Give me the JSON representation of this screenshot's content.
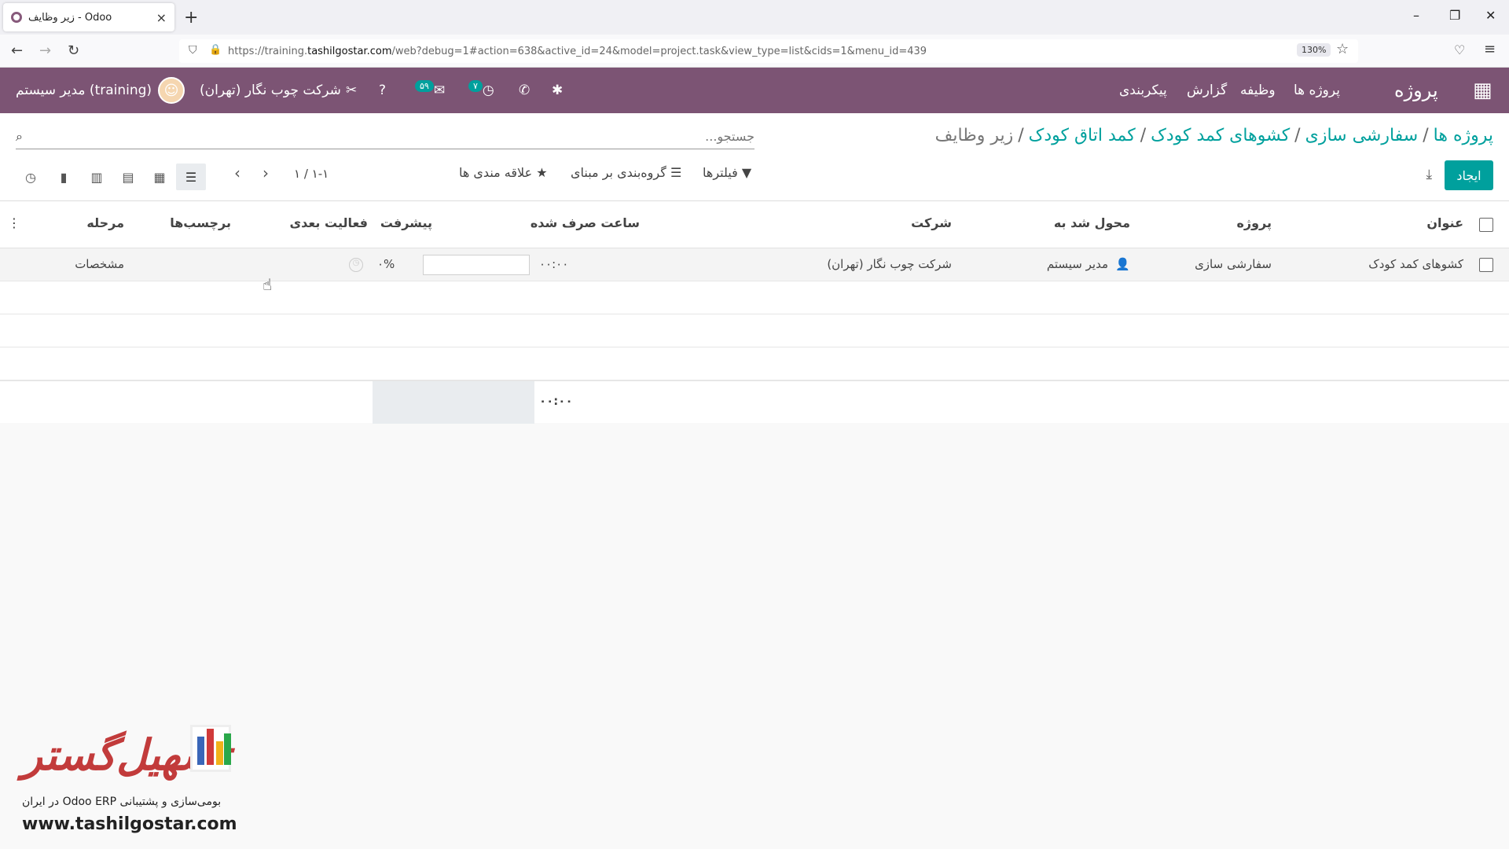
{
  "browser": {
    "tab_title": "زیر وظایف - Odoo",
    "url_prefix": "https://training.",
    "url_domain": "tashilgostar.com",
    "url_rest": "/web?debug=1#action=638&active_id=24&model=project.task&view_type=list&cids=1&menu_id=439",
    "zoom": "130%"
  },
  "navbar": {
    "app_title": "پروژه",
    "menu": [
      "پروژه ها",
      "وظیفه",
      "گزارش",
      "پیکربندی"
    ],
    "user": "مدیر سیستم (training)",
    "company": "شرکت چوب نگار (تهران)",
    "messages_count": "۵۹",
    "activities_count": "۷"
  },
  "control": {
    "breadcrumb": [
      "پروژه ها",
      "سفارشی سازی",
      "کشوهای کمد کودک",
      "کمد اتاق کودک",
      "زیر وظایف"
    ],
    "search_placeholder": "جستجو...",
    "create_label": "ایجاد",
    "filters_label": "فیلترها",
    "groupby_label": "گروه‌بندی بر مبنای",
    "favorites_label": "علاقه مندی ها",
    "pager": "۱-۱ / ۱"
  },
  "table": {
    "columns": [
      "عنوان",
      "پروژه",
      "محول شد به",
      "شرکت",
      "ساعت صرف شده",
      "پیشرفت",
      "فعالیت بعدی",
      "برچسب‌ها",
      "مرحله"
    ],
    "rows": [
      {
        "title": "کشوهای کمد کودک",
        "project": "سفارشی سازی",
        "assigned": "مدیر سیستم",
        "company": "شرکت چوب نگار (تهران)",
        "hours": "۰۰:۰۰",
        "progress": "۰%",
        "next_activity": "",
        "tags": "",
        "stage": "مشخصات"
      }
    ],
    "total_hours": "۰۰:۰۰"
  },
  "watermark": {
    "brand": "تسهیل‌گستر",
    "tagline": "بومی‌سازی و پشتیبانی Odoo ERP در ایران",
    "site": "www.tashilgostar.com"
  },
  "colors": {
    "navbar": "#7c5474",
    "accent": "#00a09d"
  }
}
